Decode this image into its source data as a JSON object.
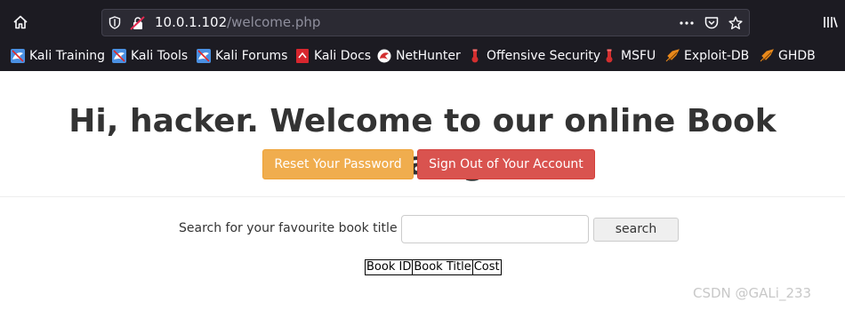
{
  "browser": {
    "url_host": "10.0.1.102",
    "url_path": "/welcome.php",
    "bookmarks": [
      {
        "label": "Kali Training",
        "icon": "kali-dragon-icon"
      },
      {
        "label": "Kali Tools",
        "icon": "kali-dragon-icon"
      },
      {
        "label": "Kali Forums",
        "icon": "kali-dragon-icon"
      },
      {
        "label": "Kali Docs",
        "icon": "kali-docs-icon"
      },
      {
        "label": "NetHunter",
        "icon": "nethunter-icon"
      },
      {
        "label": "Offensive Security",
        "icon": "offsec-icon"
      },
      {
        "label": "MSFU",
        "icon": "offsec-icon"
      },
      {
        "label": "Exploit-DB",
        "icon": "exploit-db-icon"
      },
      {
        "label": "GHDB",
        "icon": "exploit-db-icon"
      }
    ]
  },
  "page": {
    "greeting_prefix": "Hi, ",
    "username": "hacker",
    "greeting_suffix": ". Welcome to our online Book Catalog.",
    "reset_button": "Reset Your Password",
    "signout_button": "Sign Out of Your Account",
    "search_label": "Search for your favourite book title",
    "search_value": "",
    "search_button": "search",
    "table_headers": [
      "Book ID",
      "Book Title",
      "Cost"
    ]
  },
  "watermark": "CSDN @GALi_233",
  "colors": {
    "chrome_bg": "#1c1b22",
    "urlbar_bg": "#2b2a33",
    "warning_button": "#f0ad4e",
    "danger_button": "#d9534f"
  }
}
